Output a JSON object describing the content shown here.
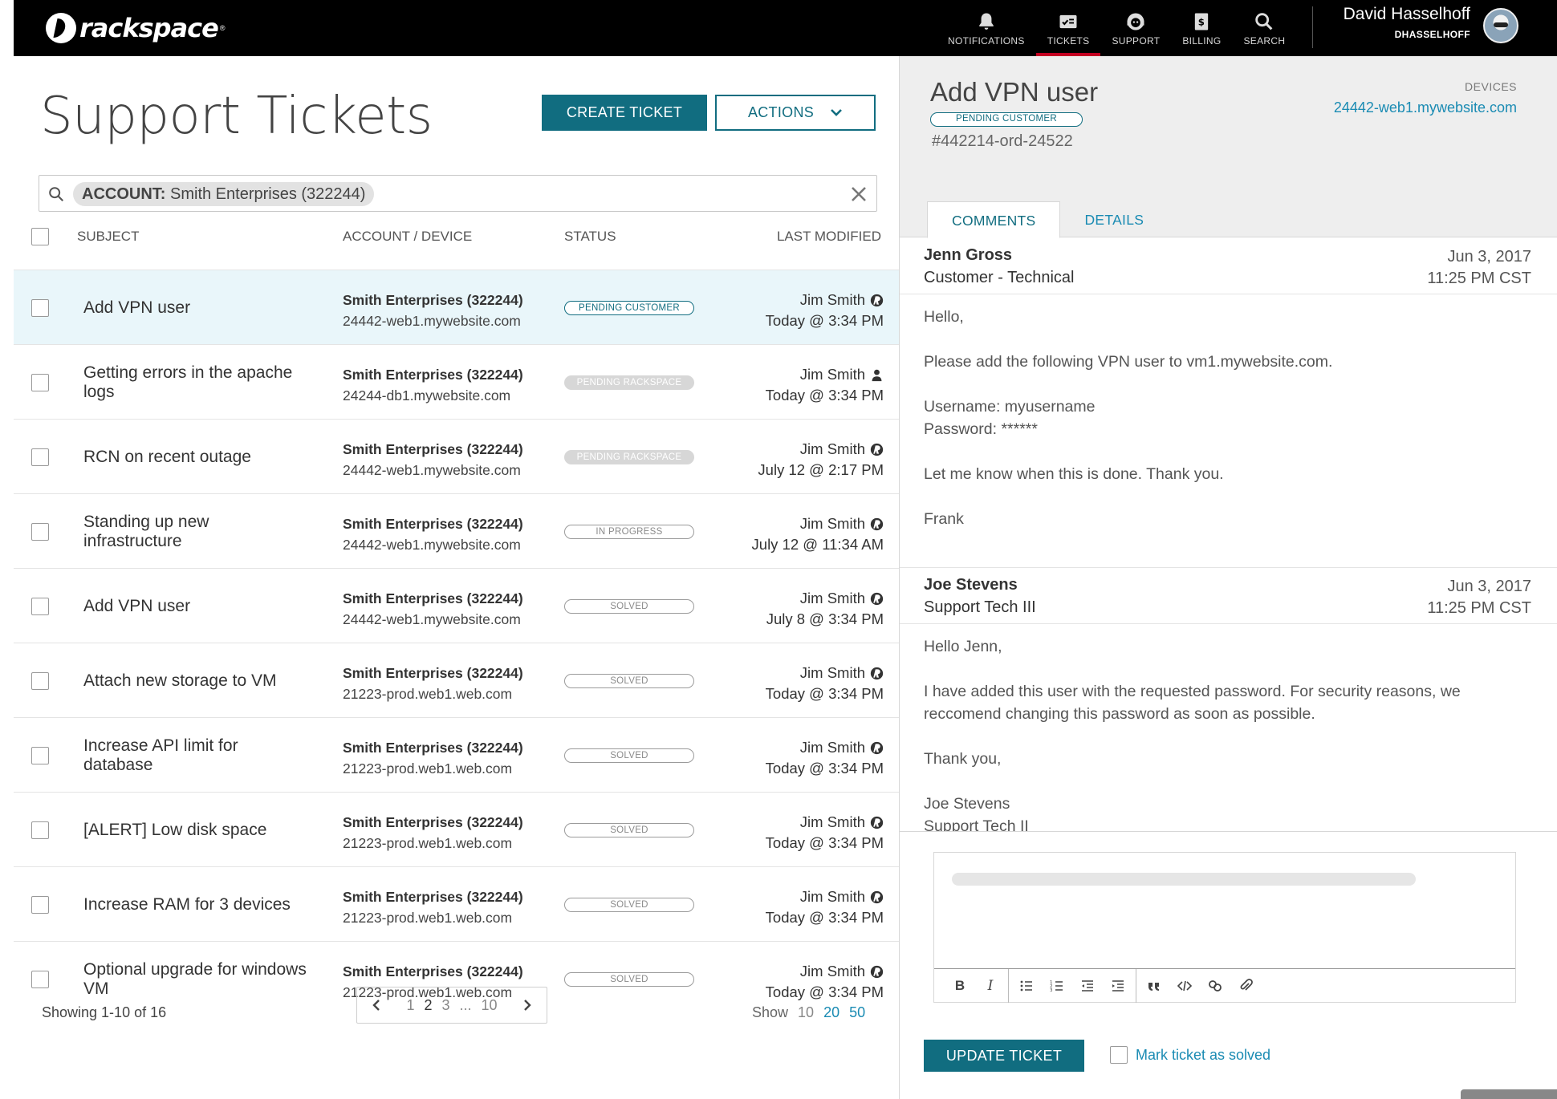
{
  "brand": {
    "logo_text": "rackspace",
    "tm": "®"
  },
  "nav": [
    {
      "label": "NOTIFICATIONS",
      "icon": "bell-icon"
    },
    {
      "label": "TICKETS",
      "icon": "tickets-icon",
      "active": true
    },
    {
      "label": "SUPPORT",
      "icon": "support-icon"
    },
    {
      "label": "BILLING",
      "icon": "billing-icon"
    },
    {
      "label": "SEARCH",
      "icon": "search-icon"
    }
  ],
  "user": {
    "name": "David Hasselhoff",
    "username": "DHASSELHOFF"
  },
  "page": {
    "title": "Support Tickets",
    "create_label": "CREATE TICKET",
    "actions_label": "ACTIONS"
  },
  "search": {
    "chip_key": "ACCOUNT:",
    "chip_value": " Smith Enterprises (322244)"
  },
  "table": {
    "headers": {
      "subject": "SUBJECT",
      "account": "ACCOUNT / DEVICE",
      "status": "STATUS",
      "modified": "LAST MODIFIED"
    },
    "rows": [
      {
        "subject": "Add VPN user",
        "account": "Smith Enterprises (322244)",
        "device": "24442-web1.mywebsite.com",
        "status": "PENDING CUSTOMER",
        "status_class": "pending-customer",
        "who": "Jim Smith",
        "who_icon": "rackspace-icon",
        "when": "Today @ 3:34 PM",
        "selected": true
      },
      {
        "subject": "Getting errors in the apache logs",
        "account": "Smith Enterprises (322244)",
        "device": "24244-db1.mywebsite.com",
        "status": "PENDING RACKSPACE",
        "status_class": "pending-rackspace",
        "who": "Jim Smith",
        "who_icon": "person-icon",
        "when": "Today @ 3:34 PM"
      },
      {
        "subject": "RCN on recent outage",
        "account": "Smith Enterprises (322244)",
        "device": "24442-web1.mywebsite.com",
        "status": "PENDING RACKSPACE",
        "status_class": "pending-rackspace",
        "who": "Jim Smith",
        "who_icon": "rackspace-icon",
        "when": "July 12 @ 2:17 PM"
      },
      {
        "subject": "Standing up new infrastructure",
        "account": "Smith Enterprises (322244)",
        "device": "24442-web1.mywebsite.com",
        "status": "IN PROGRESS",
        "status_class": "in-progress",
        "who": "Jim Smith",
        "who_icon": "rackspace-icon",
        "when": "July 12 @ 11:34 AM"
      },
      {
        "subject": "Add VPN user",
        "account": "Smith Enterprises (322244)",
        "device": "24442-web1.mywebsite.com",
        "status": "SOLVED",
        "status_class": "solved",
        "who": "Jim Smith",
        "who_icon": "rackspace-icon",
        "when": "July 8 @ 3:34 PM"
      },
      {
        "subject": "Attach new storage to VM",
        "account": "Smith Enterprises (322244)",
        "device": "21223-prod.web1.web.com",
        "status": "SOLVED",
        "status_class": "solved",
        "who": "Jim Smith",
        "who_icon": "rackspace-icon",
        "when": "Today @ 3:34 PM"
      },
      {
        "subject": "Increase API limit for database",
        "account": "Smith Enterprises (322244)",
        "device": "21223-prod.web1.web.com",
        "status": "SOLVED",
        "status_class": "solved",
        "who": "Jim Smith",
        "who_icon": "rackspace-icon",
        "when": "Today @ 3:34 PM"
      },
      {
        "subject": "[ALERT] Low disk space",
        "account": "Smith Enterprises (322244)",
        "device": "21223-prod.web1.web.com",
        "status": "SOLVED",
        "status_class": "solved",
        "who": "Jim Smith",
        "who_icon": "rackspace-icon",
        "when": "Today @ 3:34 PM"
      },
      {
        "subject": "Increase RAM for 3 devices",
        "account": "Smith Enterprises (322244)",
        "device": "21223-prod.web1.web.com",
        "status": "SOLVED",
        "status_class": "solved",
        "who": "Jim Smith",
        "who_icon": "rackspace-icon",
        "when": "Today @ 3:34 PM"
      },
      {
        "subject": "Optional upgrade for windows VM",
        "account": "Smith Enterprises (322244)",
        "device": "21223-prod.web1.web.com",
        "status": "SOLVED",
        "status_class": "solved",
        "who": "Jim Smith",
        "who_icon": "rackspace-icon",
        "when": "Today @ 3:34 PM"
      }
    ]
  },
  "pagination": {
    "showing": "Showing 1-10 of 16",
    "pages": [
      "1",
      "2",
      "3",
      "...",
      "10"
    ],
    "current": "2",
    "show_label": "Show",
    "show_options": [
      "10",
      "20",
      "50"
    ],
    "show_selected": "10"
  },
  "detail": {
    "title": "Add VPN user",
    "status": "PENDING CUSTOMER",
    "number": "#442214-ord-24522",
    "devices_label": "DEVICES",
    "device": "24442-web1.mywebsite.com",
    "tabs": [
      "COMMENTS",
      "DETAILS"
    ],
    "comments": [
      {
        "name": "Jenn Gross",
        "role": "Customer - Technical",
        "date": "Jun 3, 2017",
        "time": "11:25 PM CST",
        "body": [
          "Hello,",
          "Please add the following VPN user to vm1.mywebsite.com.",
          "Username: myusername",
          "Password: ******",
          "Let me know when this is done. Thank you.",
          "Frank"
        ]
      },
      {
        "name": "Joe Stevens",
        "role": "Support Tech III",
        "date": "Jun 3, 2017",
        "time": "11:25 PM CST",
        "body": [
          "Hello Jenn,",
          "I have added this user with the requested password. For security reasons, we reccomend changing this password as soon as possible.",
          "Thank you,",
          "Joe Stevens",
          "Support Tech II"
        ]
      }
    ],
    "update_label": "UPDATE TICKET",
    "solve_label": "Mark ticket as solved"
  },
  "colors": {
    "accent": "#116d80",
    "link": "#1a8bb3",
    "nav_active": "#c40022",
    "selected_row": "#e9f6fa"
  }
}
